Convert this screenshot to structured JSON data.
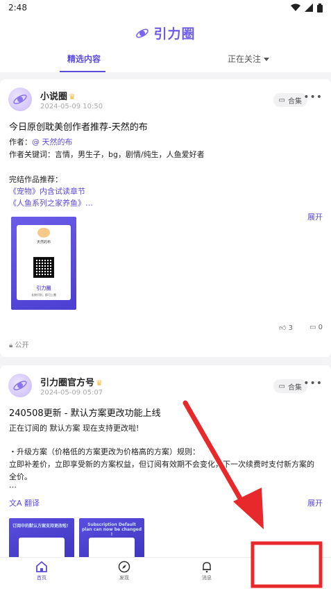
{
  "status_bar": {
    "time": "2:48"
  },
  "header": {
    "brand": "引力圈",
    "tabs": [
      {
        "label": "精选内容",
        "selected": true
      },
      {
        "label": "正在关注",
        "selected": false
      }
    ]
  },
  "posts": [
    {
      "author": "小说圈",
      "date": "2024-05-09 10:50",
      "collect_label": "合集",
      "title": "今日原创耽美创作者推荐-天然的布",
      "author_label": "作者：",
      "author_link": "@ 天然的布",
      "keywords": "作者关键词：言情，男生子，bg，剧情/纯生，人鱼爱好者",
      "completed_label": "完结作品推荐：",
      "works": [
        "《宠物》内含试读章节",
        "《人鱼系列之家养鱼》…"
      ],
      "expand_label": "展开",
      "poster": {
        "name": "天然的布",
        "brand": "引力圈",
        "note": "长按识别，即可上圈"
      },
      "likes": "3",
      "comments": "0",
      "visibility": "公开"
    },
    {
      "author": "引力圈官方号",
      "date": "2024-05-09 05:07",
      "collect_label": "合集",
      "title": "240508更新 - 默认方案更改功能上线",
      "line1": "正在订阅的 默认方案 现在支持更改啦!",
      "line2": "・升级方案（价格低的方案更改为价格高的方案）规则：",
      "line3": "立即补差价，立即享受新的方案权益，但订阅有效期不会变化，下一次续费时支付新方案的",
      "line4": "全价。",
      "line5": "…",
      "translate_label": "翻译",
      "expand_label": "展开",
      "thumbs": [
        "订阅中的默认方案支持更改啦！",
        "Subscription Default plan can now be changed !"
      ]
    }
  ],
  "bottom_nav": [
    {
      "label": "首页",
      "icon": "home-icon",
      "active": true
    },
    {
      "label": "发现",
      "icon": "compass-icon",
      "active": false
    },
    {
      "label": "消息",
      "icon": "bell-icon",
      "active": false
    }
  ],
  "colors": {
    "accent": "#5b4bdb",
    "annotation": "#e8292b"
  }
}
